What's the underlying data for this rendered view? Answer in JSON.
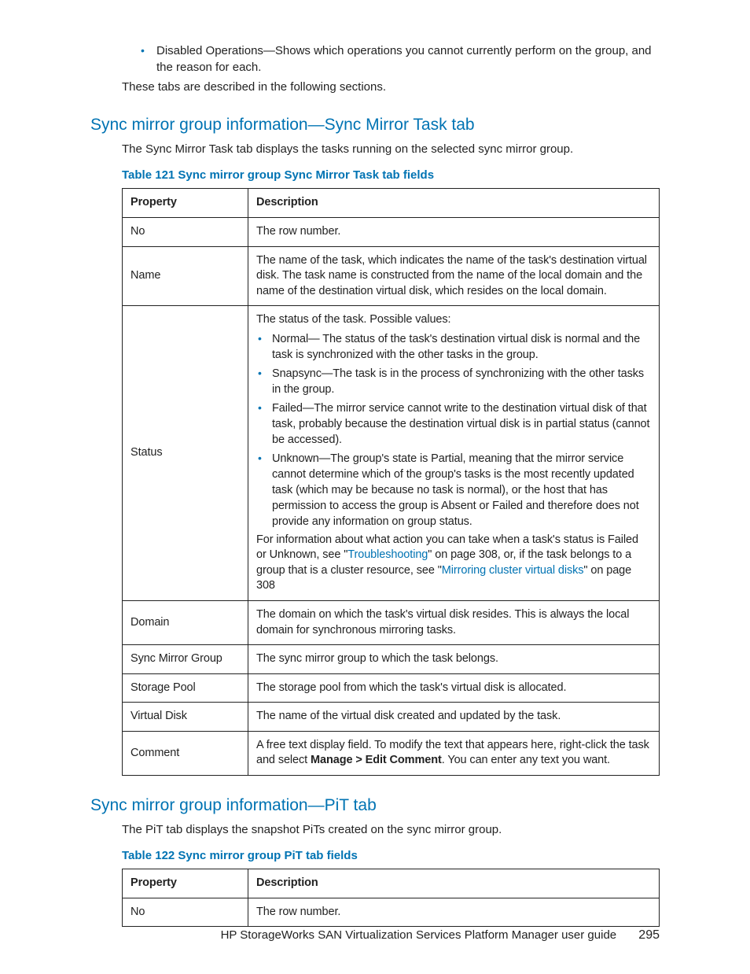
{
  "intro": {
    "bullet_text_a": "Disabled Operations—Shows which operations you cannot currently perform on the group, and the reason for each.",
    "after_bullets": "These tabs are described in the following sections."
  },
  "section1": {
    "heading": "Sync mirror group information—Sync Mirror Task tab",
    "lead": "The Sync Mirror Task tab displays the tasks running on the selected sync mirror group.",
    "caption": "Table 121 Sync mirror group Sync Mirror Task tab fields",
    "headers": {
      "prop": "Property",
      "desc": "Description"
    },
    "rows": {
      "no": {
        "prop": "No",
        "desc": "The row number."
      },
      "name": {
        "prop": "Name",
        "desc": "The name of the task, which indicates the name of the task's destination virtual disk. The task name is constructed from the name of the local domain and the name of the destination virtual disk, which resides on the local domain."
      },
      "status": {
        "prop": "Status",
        "lead": "The status of the task. Possible values:",
        "b1": "Normal— The status of the task's destination virtual disk is normal and the task is synchronized with the other tasks in the group.",
        "b2": "Snapsync—The task is in the process of synchronizing with the other tasks in the group.",
        "b3": "Failed—The mirror service cannot write to the destination virtual disk of that task, probably because the destination virtual disk is in partial status (cannot be accessed).",
        "b4": "Unknown—The group's state is Partial, meaning that the mirror service cannot determine which of the group's tasks is the most recently updated task (which may be because no task is normal), or the host that has permission to access the group is Absent or Failed and therefore does not provide any information on group status.",
        "tail_a": "For information about what action you can take when a task's status is Failed or Unknown, see \"",
        "tail_link1": "Troubleshooting",
        "tail_b": "\" on page 308, or, if the task belongs to a group that is a cluster resource, see \"",
        "tail_link2": "Mirroring cluster virtual disks",
        "tail_c": "\" on page 308"
      },
      "domain": {
        "prop": "Domain",
        "desc": "The domain on which the task's virtual disk resides. This is always the local domain for synchronous mirroring tasks."
      },
      "smg": {
        "prop": "Sync Mirror Group",
        "desc": "The sync mirror group to which the task belongs."
      },
      "sp": {
        "prop": "Storage Pool",
        "desc": "The storage pool from which the task's virtual disk is allocated."
      },
      "vd": {
        "prop": "Virtual Disk",
        "desc": "The name of the virtual disk created and updated by the task."
      },
      "comment": {
        "prop": "Comment",
        "desc_a": "A free text display field. To modify the text that appears here, right-click the task and select ",
        "desc_bold": "Manage > Edit Comment",
        "desc_b": ". You can enter any text you want."
      }
    }
  },
  "section2": {
    "heading": "Sync mirror group information—PiT tab",
    "lead": "The PiT tab displays the snapshot PiTs created on the sync mirror group.",
    "caption": "Table 122 Sync mirror group PiT tab fields",
    "headers": {
      "prop": "Property",
      "desc": "Description"
    },
    "rows": {
      "no": {
        "prop": "No",
        "desc": "The row number."
      }
    }
  },
  "footer": {
    "text": "HP StorageWorks SAN Virtualization Services Platform Manager user guide",
    "page": "295"
  }
}
